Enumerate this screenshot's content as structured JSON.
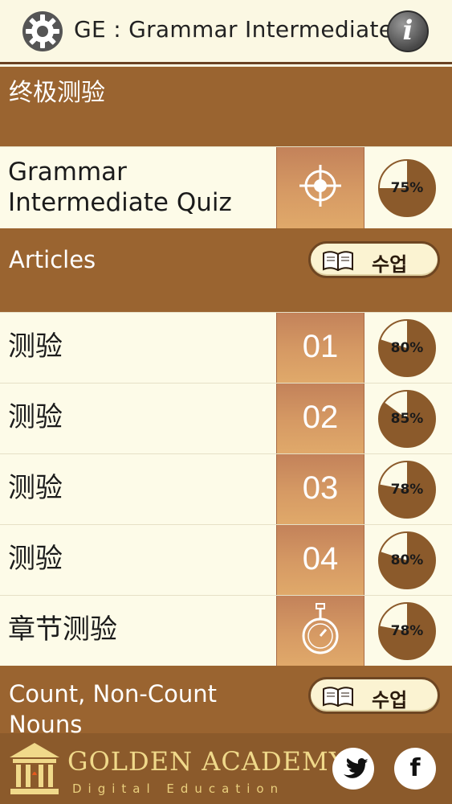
{
  "header": {
    "title": "GE : Grammar Intermediate",
    "settings_icon": "gear-icon",
    "info_icon": "info-icon",
    "info_glyph": "i"
  },
  "final_test": {
    "section_title": "终极测验",
    "quiz_label": "Grammar Intermediate Quiz",
    "quiz_label_line1": "Grammar",
    "quiz_label_line2": "Intermediate Quiz",
    "quiz_icon": "target-icon",
    "quiz_score_label": "75%",
    "quiz_score": 75
  },
  "sections": [
    {
      "title": "Articles",
      "lesson_button_label": "수업",
      "lesson_icon": "book-icon",
      "quizzes": [
        {
          "label": "测验",
          "number": "01",
          "score_label": "80%",
          "score": 80
        },
        {
          "label": "测验",
          "number": "02",
          "score_label": "85%",
          "score": 85
        },
        {
          "label": "测验",
          "number": "03",
          "score_label": "78%",
          "score": 78
        },
        {
          "label": "测验",
          "number": "04",
          "score_label": "80%",
          "score": 80
        }
      ],
      "chapter_test": {
        "label": "章节测验",
        "icon": "stopwatch-icon",
        "score_label": "78%",
        "score": 78
      }
    },
    {
      "title": "Count, Non-Count Nouns",
      "title_line1": "Count, Non-Count",
      "title_line2": "Nouns",
      "lesson_button_label": "수업",
      "lesson_icon": "book-icon"
    }
  ],
  "footer": {
    "brand": "GOLDEN ACADEMY",
    "tagline": "Digital Education",
    "twitter_icon": "twitter-icon",
    "facebook_icon": "facebook-icon",
    "facebook_glyph": "f"
  },
  "colors": {
    "section_brown": "#9a6430",
    "row_bg": "#fdfbe8",
    "pie_fill": "#8b5a2b",
    "footer_brown": "#8b5a2b",
    "brand_gold": "#f0d98a"
  }
}
